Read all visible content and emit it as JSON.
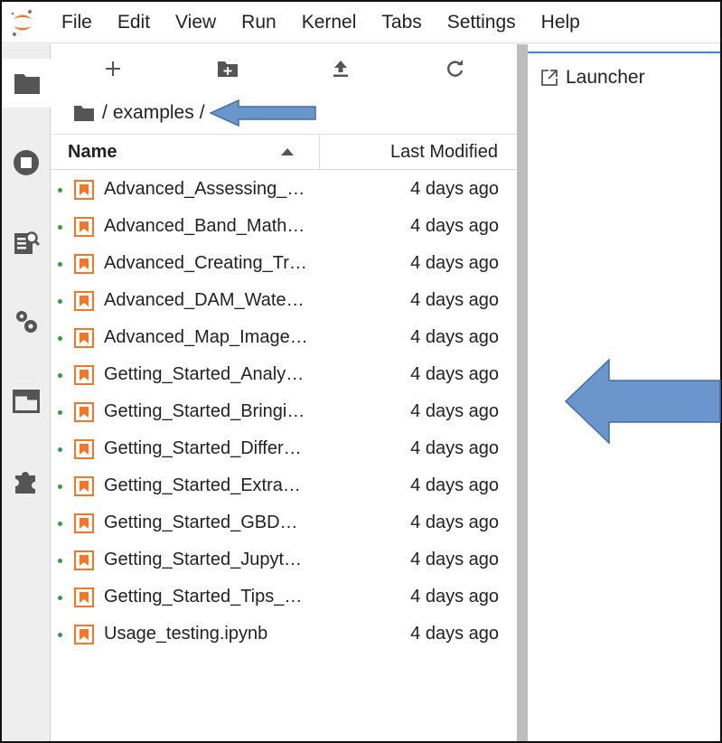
{
  "menubar": {
    "items": [
      "File",
      "Edit",
      "View",
      "Run",
      "Kernel",
      "Tabs",
      "Settings",
      "Help"
    ]
  },
  "activity_bar": {
    "icons": [
      "folder-icon",
      "running-icon",
      "property-inspector-icon",
      "gears-icon",
      "tabs-icon",
      "extension-icon"
    ]
  },
  "file_browser": {
    "breadcrumb": {
      "folder_icon": "folder-icon",
      "separator": "/",
      "path": "examples"
    },
    "columns": {
      "name": "Name",
      "modified": "Last Modified"
    },
    "files": [
      {
        "name": "Advanced_Assessing_…",
        "modified": "4 days ago"
      },
      {
        "name": "Advanced_Band_Math…",
        "modified": "4 days ago"
      },
      {
        "name": "Advanced_Creating_Tr…",
        "modified": "4 days ago"
      },
      {
        "name": "Advanced_DAM_Wate…",
        "modified": "4 days ago"
      },
      {
        "name": "Advanced_Map_Image…",
        "modified": "4 days ago"
      },
      {
        "name": "Getting_Started_Analy…",
        "modified": "4 days ago"
      },
      {
        "name": "Getting_Started_Bringi…",
        "modified": "4 days ago"
      },
      {
        "name": "Getting_Started_Differ…",
        "modified": "4 days ago"
      },
      {
        "name": "Getting_Started_Extra…",
        "modified": "4 days ago"
      },
      {
        "name": "Getting_Started_GBD…",
        "modified": "4 days ago"
      },
      {
        "name": "Getting_Started_Jupyt…",
        "modified": "4 days ago"
      },
      {
        "name": "Getting_Started_Tips_…",
        "modified": "4 days ago"
      },
      {
        "name": "Usage_testing.ipynb",
        "modified": "4 days ago"
      }
    ]
  },
  "main_area": {
    "tab": {
      "label": "Launcher",
      "icon": "launcher-icon"
    }
  },
  "colors": {
    "accent": "#2b8cf0",
    "notebook_icon": "#f37726",
    "running_dot": "#2ea043",
    "annotation_arrow": "#6b96cb"
  }
}
